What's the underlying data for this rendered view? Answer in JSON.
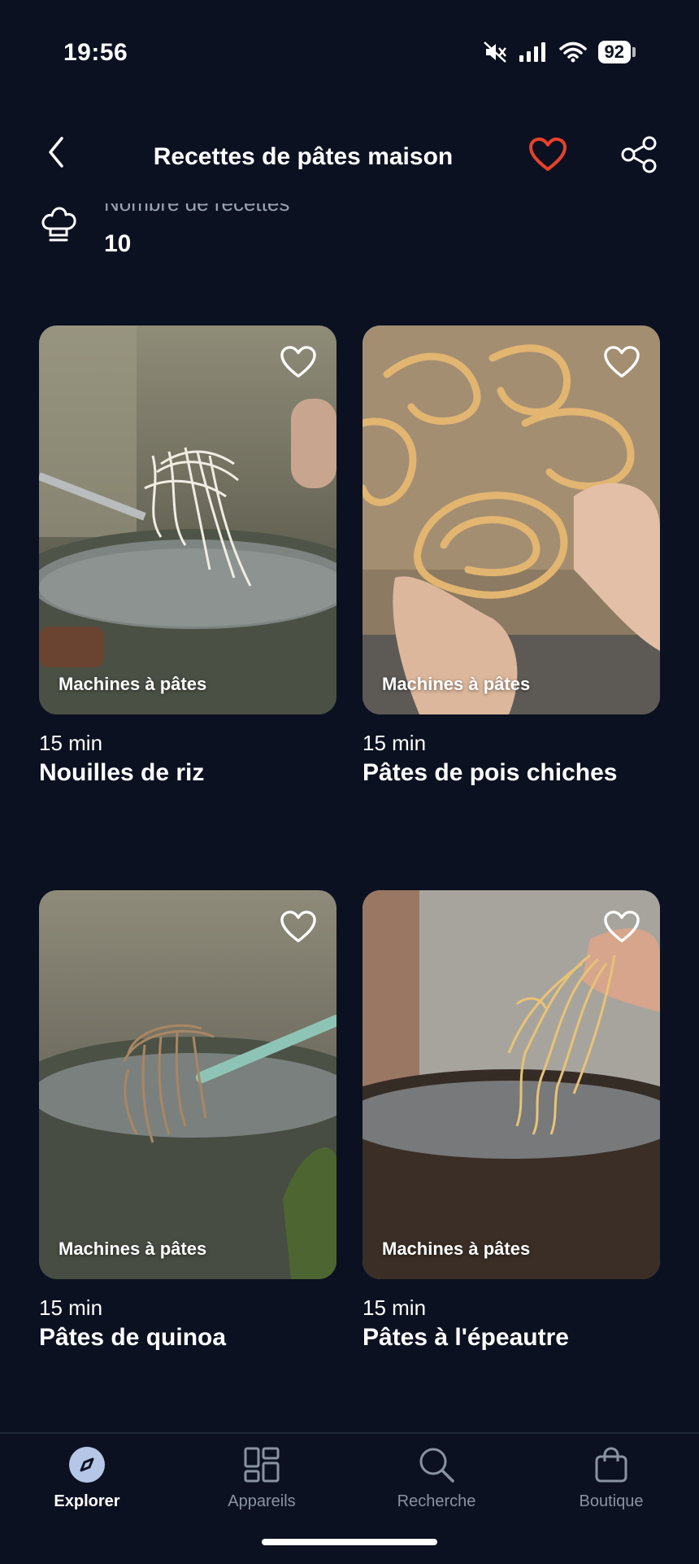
{
  "status_bar": {
    "time": "19:56",
    "battery": "92",
    "icons": [
      "mute-icon",
      "signal-icon",
      "wifi-icon",
      "battery-icon"
    ]
  },
  "header": {
    "title": "Recettes de pâtes maison",
    "back_icon": "chevron-left-icon",
    "favorite_icon": "heart-icon",
    "share_icon": "share-icon",
    "favorite_color": "#e8412c"
  },
  "recipe_count": {
    "label": "Nombre de recettes",
    "value": "10",
    "icon": "chef-hat-icon"
  },
  "recipes": [
    {
      "category": "Machines à pâtes",
      "time": "15 min",
      "title": "Nouilles de riz"
    },
    {
      "category": "Machines à pâtes",
      "time": "15 min",
      "title": "Pâtes de pois chiches"
    },
    {
      "category": "Machines à pâtes",
      "time": "15 min",
      "title": "Pâtes de quinoa"
    },
    {
      "category": "Machines à pâtes",
      "time": "15 min",
      "title": "Pâtes à l'épeautre"
    }
  ],
  "bottom_nav": {
    "items": [
      {
        "label": "Explorer",
        "icon": "compass-icon",
        "active": true
      },
      {
        "label": "Appareils",
        "icon": "grid-icon",
        "active": false
      },
      {
        "label": "Recherche",
        "icon": "search-icon",
        "active": false
      },
      {
        "label": "Boutique",
        "icon": "bag-icon",
        "active": false
      }
    ]
  }
}
